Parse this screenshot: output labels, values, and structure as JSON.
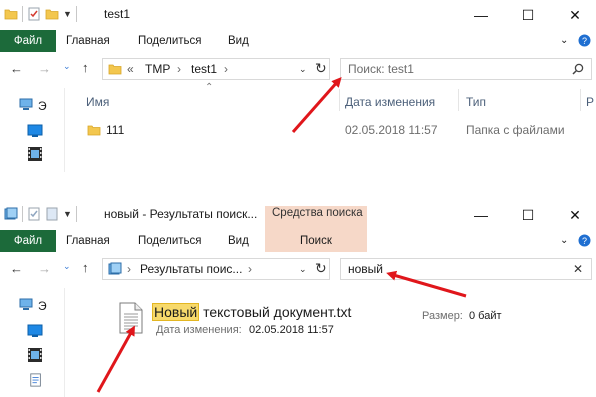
{
  "window1": {
    "title": "test1",
    "ribbon_tabs": [
      "Файл",
      "Главная",
      "Поделиться",
      "Вид"
    ],
    "address": {
      "overflow": "«",
      "crumbs": [
        "TMP",
        "test1"
      ]
    },
    "search_placeholder": "Поиск: test1",
    "columns": [
      "Имя",
      "Дата изменения",
      "Тип",
      "Р"
    ],
    "sidebar_label": "Э",
    "rows": [
      {
        "name": "111",
        "date": "02.05.2018 11:57",
        "type": "Папка с файлами"
      }
    ]
  },
  "window2": {
    "title": "новый - Результаты поиск...",
    "context_group": "Средства поиска",
    "ribbon_tabs": [
      "Файл",
      "Главная",
      "Поделиться",
      "Вид",
      "Поиск"
    ],
    "address": {
      "crumbs": [
        "Результаты поис..."
      ]
    },
    "search_value": "новый",
    "sidebar_label": "Э",
    "result": {
      "name_match": "Новый",
      "name_rest": " текстовый документ.txt",
      "date_label": "Дата изменения:",
      "date_value": "02.05.2018 11:57",
      "size_label": "Размер:",
      "size_value": "0 байт"
    }
  },
  "colors": {
    "file_tab": "#1c6a3a",
    "context_tab": "#f6d8c8",
    "arrow": "#e0161b",
    "highlight": "#f7d96b"
  },
  "icons": [
    "folder-icon",
    "checklist-icon",
    "dropdown-icon",
    "minimize-icon",
    "maximize-icon",
    "close-icon",
    "back-icon",
    "forward-icon",
    "recent-icon",
    "up-icon",
    "refresh-icon",
    "search-icon",
    "clear-icon",
    "help-icon",
    "chevron-icon",
    "computer-icon",
    "desktop-icon",
    "video-icon",
    "document-icon"
  ]
}
